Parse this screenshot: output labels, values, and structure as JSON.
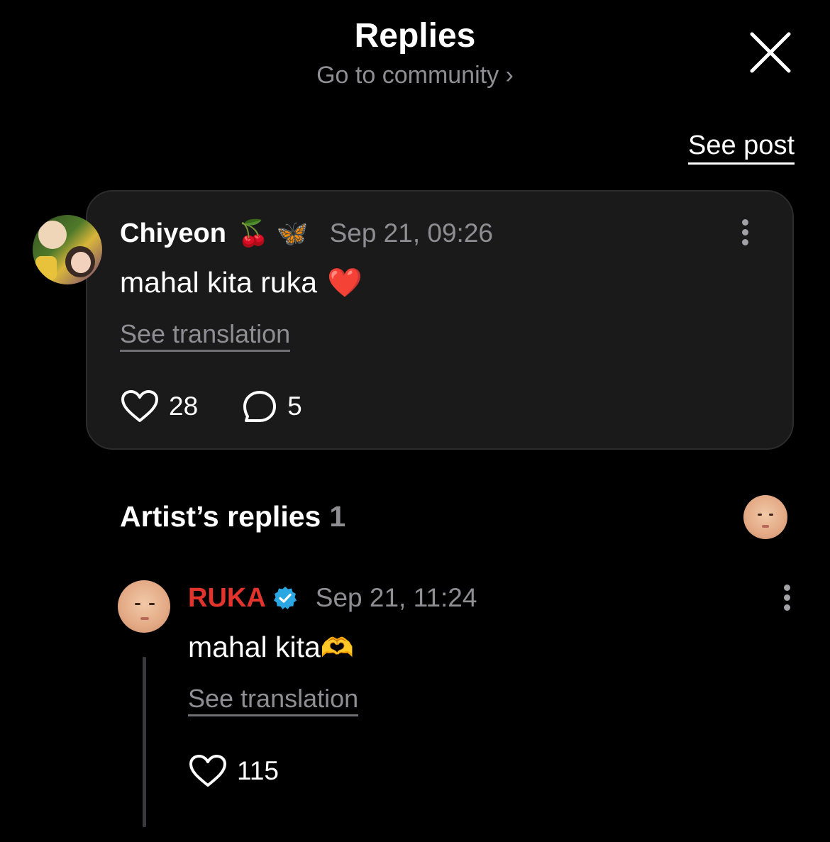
{
  "header": {
    "title": "Replies",
    "subtitle": "Go to community",
    "subtitle_chevron": "›",
    "close_icon": "close-icon"
  },
  "see_post_label": "See post",
  "comment": {
    "author": "Chiyeon",
    "author_emojis": [
      "🍒",
      "🦋"
    ],
    "timestamp": "Sep 21, 09:26",
    "text": "mahal kita ruka",
    "text_emoji": "❤️",
    "translate_label": "See translation",
    "likes": "28",
    "replies": "5"
  },
  "artist_replies": {
    "title": "Artist’s replies",
    "count": "1"
  },
  "reply": {
    "author": "RUKA",
    "verified": true,
    "timestamp": "Sep 21, 11:24",
    "text": "mahal kita",
    "text_emoji": "🫶",
    "translate_label": "See translation",
    "likes": "115"
  },
  "colors": {
    "background": "#000000",
    "card": "#1a1a1a",
    "muted_text": "#8e8e93",
    "artist_name": "#e2332d",
    "verified_badge": "#2aa7e2"
  }
}
